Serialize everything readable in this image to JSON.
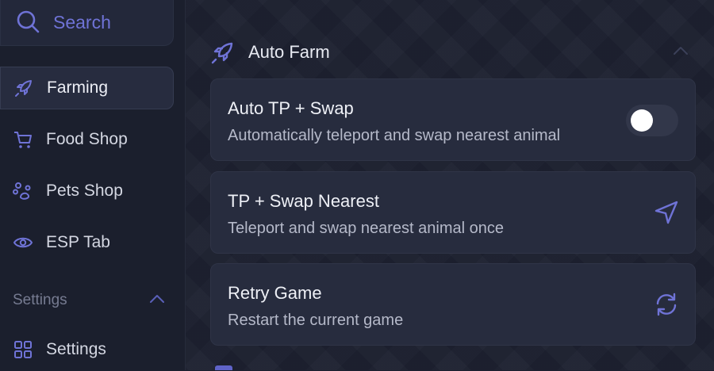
{
  "colors": {
    "accent": "#6f73d6",
    "background": "#1e2232",
    "card": "#272c3e"
  },
  "search": {
    "label": "Search",
    "icon": "search-icon"
  },
  "sidebar": {
    "items": [
      {
        "label": "Farming",
        "icon": "rocket-icon",
        "active": true
      },
      {
        "label": "Food Shop",
        "icon": "cart-icon",
        "active": false
      },
      {
        "label": "Pets Shop",
        "icon": "paw-icon",
        "active": false
      },
      {
        "label": "ESP Tab",
        "icon": "eye-icon",
        "active": false
      }
    ],
    "section": {
      "label": "Settings",
      "icon": "chevron-up-icon"
    },
    "settings_item": {
      "label": "Settings",
      "icon": "grid-icon"
    }
  },
  "main": {
    "section_title": "Auto Farm",
    "section_icon": "rocket-icon",
    "cards": [
      {
        "title": "Auto TP + Swap",
        "description": "Automatically teleport and swap nearest animal",
        "control": "toggle",
        "toggle_on": false
      },
      {
        "title": "TP + Swap Nearest",
        "description": "Teleport and swap nearest animal once",
        "control": "send-icon"
      },
      {
        "title": "Retry Game",
        "description": "Restart the current game",
        "control": "refresh-icon"
      }
    ]
  }
}
